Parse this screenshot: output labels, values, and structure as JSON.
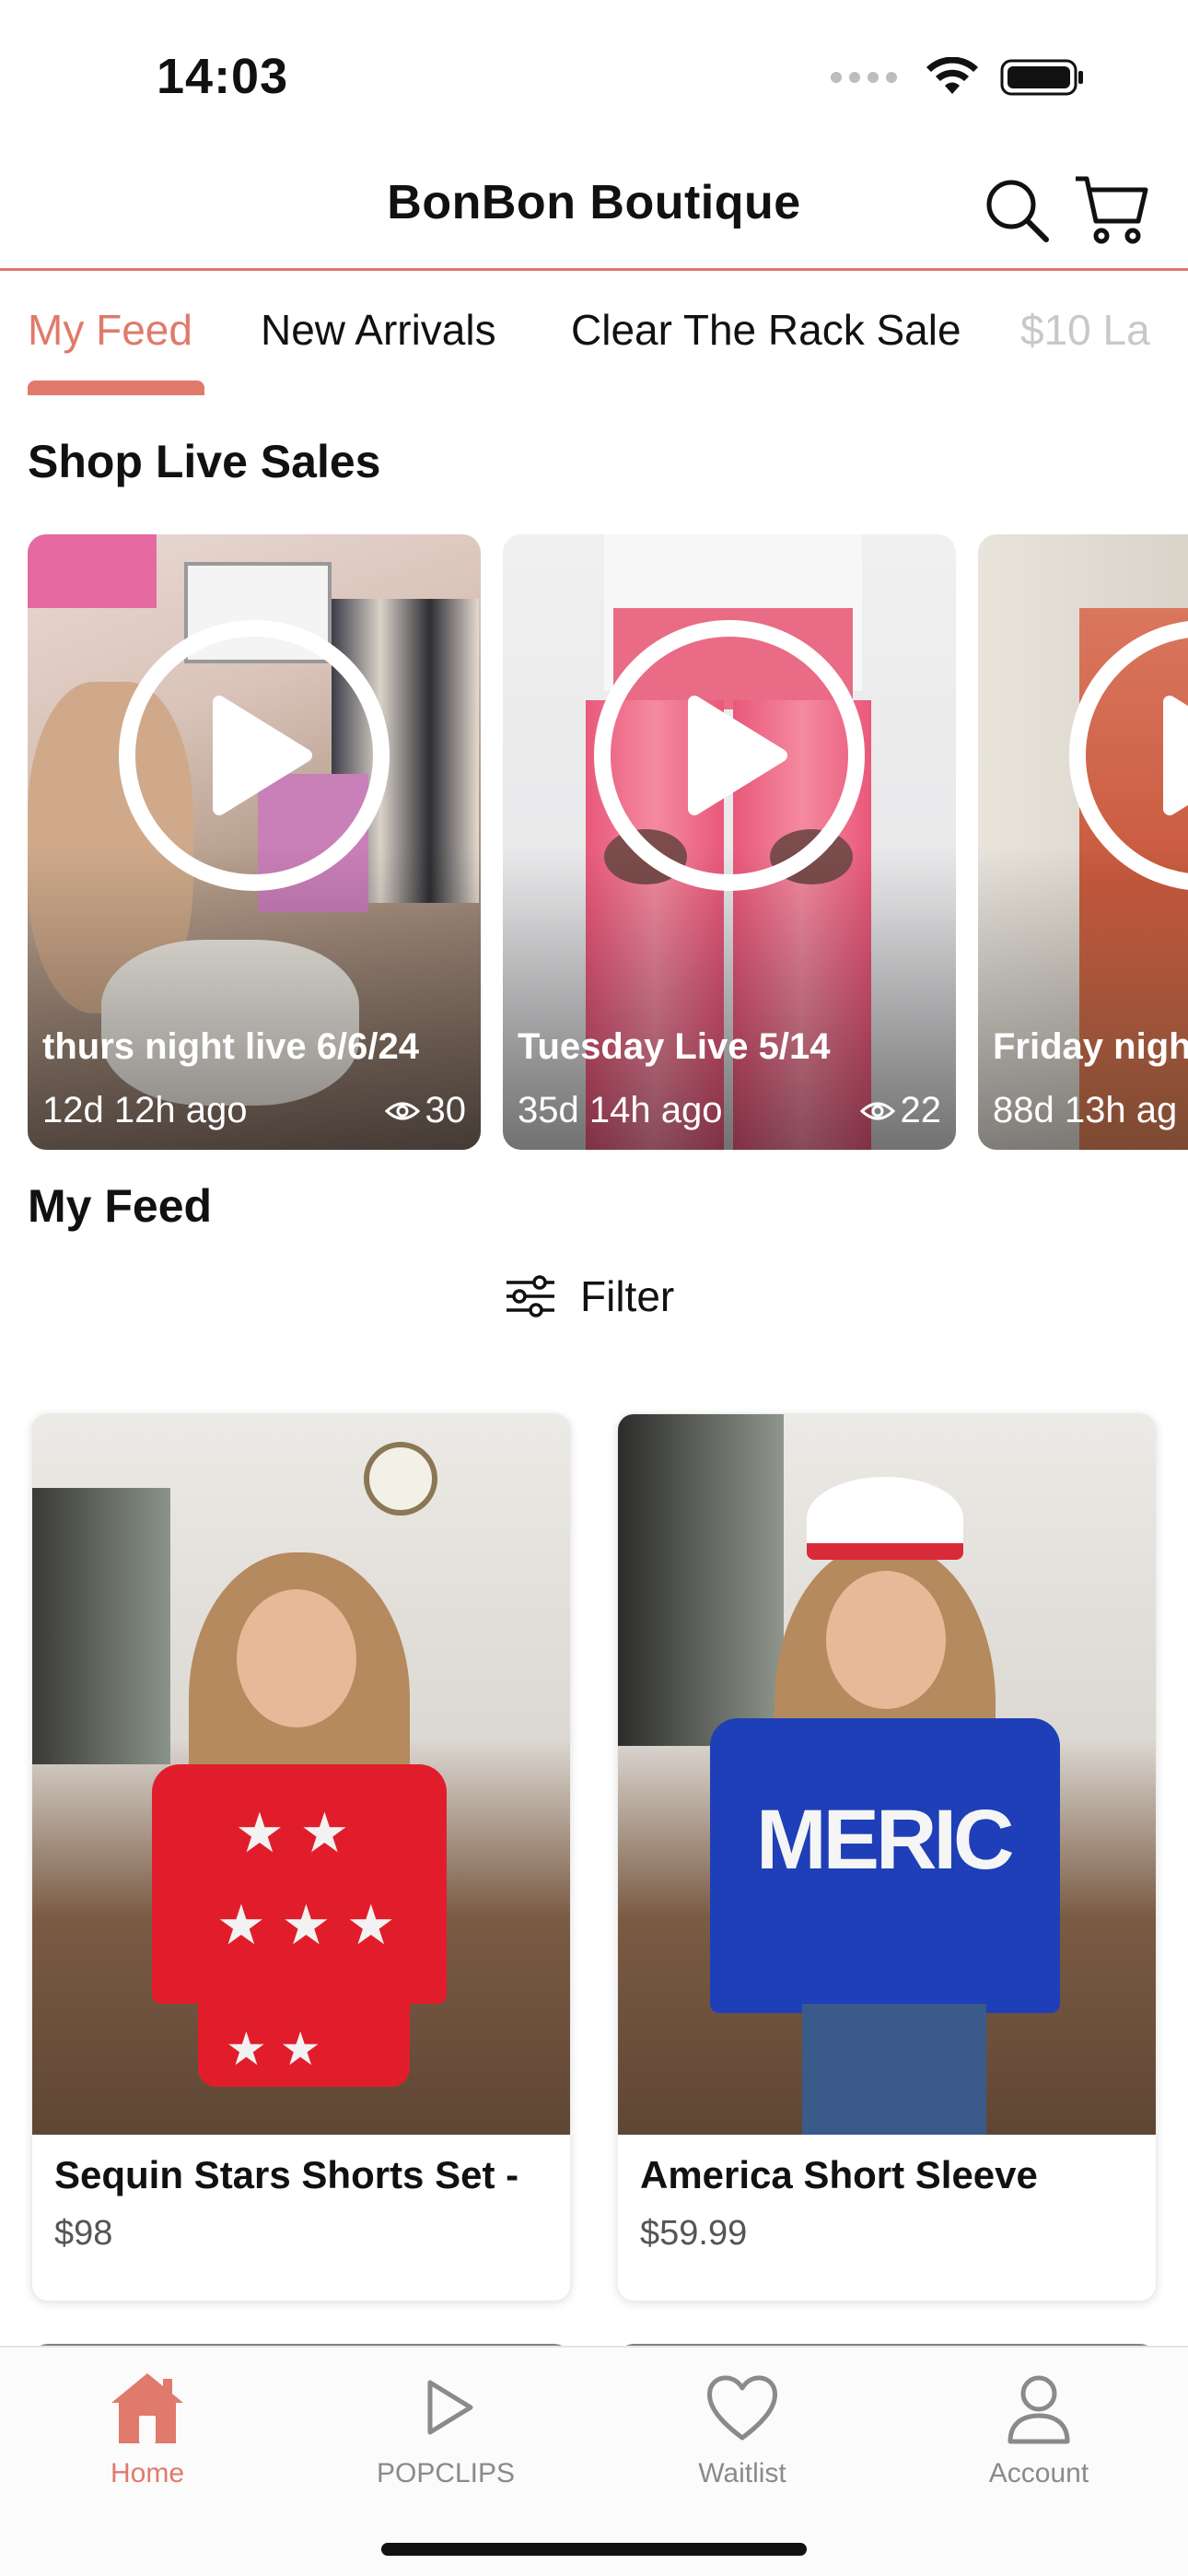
{
  "status_bar": {
    "time": "14:03"
  },
  "header": {
    "title": "BonBon Boutique",
    "search_icon": "search-icon",
    "cart_icon": "cart-icon"
  },
  "tabs": [
    {
      "label": "My Feed",
      "active": true
    },
    {
      "label": "New Arrivals"
    },
    {
      "label": "Clear The Rack Sale"
    },
    {
      "label": "$10 La"
    }
  ],
  "live_sales": {
    "title": "Shop Live Sales",
    "cards": [
      {
        "title": "thurs night live 6/6/24",
        "ago": "12d 12h ago",
        "views": "30"
      },
      {
        "title": "Tuesday Live 5/14",
        "ago": "35d 14h ago",
        "views": "22"
      },
      {
        "title": "Friday nigh",
        "ago": "88d 13h ag",
        "views": ""
      }
    ]
  },
  "feed": {
    "title": "My Feed",
    "filter_label": "Filter",
    "products": [
      {
        "name": "Sequin Stars Shorts Set -",
        "price": "$98"
      },
      {
        "name": "America Short Sleeve",
        "price": "$59.99"
      }
    ]
  },
  "bottom_nav": [
    {
      "label": "Home",
      "icon": "home-icon",
      "active": true
    },
    {
      "label": "POPCLIPS",
      "icon": "play-icon"
    },
    {
      "label": "Waitlist",
      "icon": "heart-icon"
    },
    {
      "label": "Account",
      "icon": "person-icon"
    }
  ],
  "colors": {
    "accent": "#e07a6c",
    "text": "#111111",
    "muted": "#8a8a8a"
  }
}
